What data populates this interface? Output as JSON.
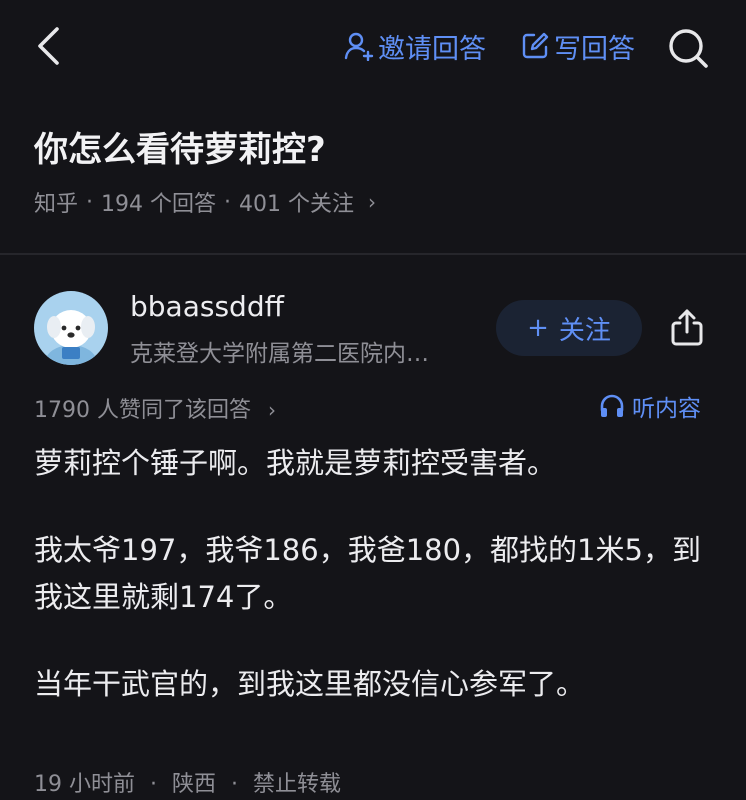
{
  "header": {
    "invite_label": "邀请回答",
    "write_label": "写回答"
  },
  "question": {
    "title": "你怎么看待萝莉控?",
    "source": "知乎",
    "answers_count": "194 个回答",
    "followers_count": "401 个关注"
  },
  "answer": {
    "author_name": "bbaassddff",
    "author_bio": "克莱登大学附属第二医院内…",
    "follow_label": "关注",
    "likes_text": "1790 人赞同了该回答",
    "listen_label": "听内容",
    "paragraphs": [
      "萝莉控个锤子啊。我就是萝莉控受害者。",
      "我太爷197，我爷186，我爸180，都找的1米5，到我这里就剩174了。",
      "当年干武官的，到我这里都没信心参军了。"
    ],
    "time": "19 小时前",
    "location": "陕西",
    "copyright": "禁止转载"
  },
  "icons": {
    "back": "chevron-left-icon",
    "invite": "person-add-icon",
    "write": "edit-icon",
    "search": "search-icon",
    "share": "share-icon",
    "listen": "headphones-icon"
  },
  "colors": {
    "background": "#141418",
    "accent": "#5f8ff5",
    "follow_bg": "#1b2333",
    "secondary_text": "#8f8f96"
  }
}
